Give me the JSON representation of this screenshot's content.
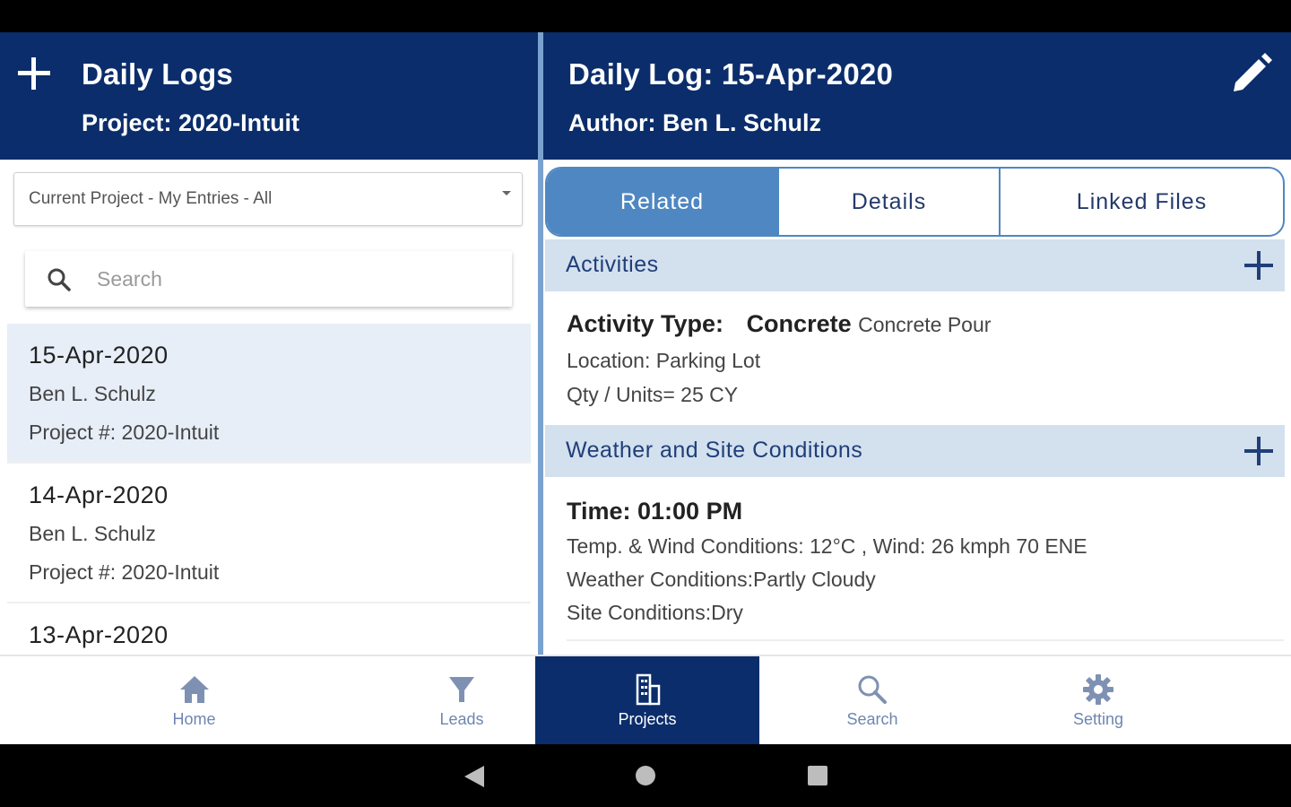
{
  "left_header": {
    "title": "Daily Logs",
    "subtitle": "Project: 2020-Intuit"
  },
  "right_header": {
    "title": "Daily Log: 15-Apr-2020",
    "subtitle": "Author: Ben L. Schulz"
  },
  "filter": {
    "value": "Current Project - My Entries - All"
  },
  "search": {
    "placeholder": "Search"
  },
  "logs": [
    {
      "date": "15-Apr-2020",
      "author": "Ben L. Schulz",
      "project": "Project #: 2020-Intuit",
      "selected": true
    },
    {
      "date": "14-Apr-2020",
      "author": "Ben L. Schulz",
      "project": "Project #: 2020-Intuit",
      "selected": false
    },
    {
      "date": "13-Apr-2020",
      "author": "",
      "project": "",
      "selected": false
    }
  ],
  "tabs": [
    {
      "label": "Related",
      "active": true
    },
    {
      "label": "Details",
      "active": false
    },
    {
      "label": "Linked Files",
      "active": false
    }
  ],
  "activities": {
    "header": "Activities",
    "type_label": "Activity Type:",
    "type_value": "Concrete",
    "type_detail": "Concrete Pour",
    "location": "Location:   Parking Lot",
    "qty": "Qty / Units= 25 CY"
  },
  "weather": {
    "header": "Weather and Site Conditions",
    "time": "Time: 01:00 PM",
    "temp_wind": "Temp. & Wind Conditions: 12°C , Wind: 26 kmph 70 ENE",
    "weather_conditions": "Weather Conditions:Partly Cloudy",
    "site_conditions": "Site Conditions:Dry"
  },
  "bottom_nav": [
    {
      "label": "Home",
      "icon": "home-icon",
      "active": false
    },
    {
      "label": "Leads",
      "icon": "funnel-icon",
      "active": false
    },
    {
      "label": "Projects",
      "icon": "building-icon",
      "active": true
    },
    {
      "label": "Search",
      "icon": "search-icon",
      "active": false
    },
    {
      "label": "Setting",
      "icon": "gear-icon",
      "active": false
    }
  ],
  "colors": {
    "header_bg": "#0b2d6b",
    "accent": "#4f87c2",
    "section_bg": "#d3e0ee",
    "selected_row": "#e7eef8"
  }
}
